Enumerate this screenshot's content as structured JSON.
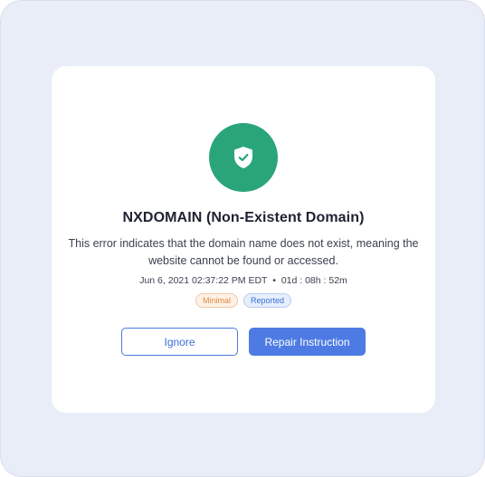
{
  "dialog": {
    "title": "NXDOMAIN (Non-Existent Domain)",
    "description": "This error indicates that the domain name does not exist, meaning the website cannot be found or accessed.",
    "timestamp": "Jun 6, 2021 02:37:22 PM EDT",
    "separator": "•",
    "duration": "01d : 08h : 52m",
    "status_icon": "shield-check-icon",
    "badges": {
      "severity": "Minimal",
      "state": "Reported"
    },
    "buttons": {
      "ignore_label": "Ignore",
      "repair_label": "Repair Instruction"
    }
  },
  "colors": {
    "background": "#e8edf7",
    "card": "#ffffff",
    "icon_circle": "#2aa57a",
    "primary": "#4d7be3",
    "badge_minimal_text": "#e08a3c",
    "badge_reported_text": "#3b6fd6"
  }
}
